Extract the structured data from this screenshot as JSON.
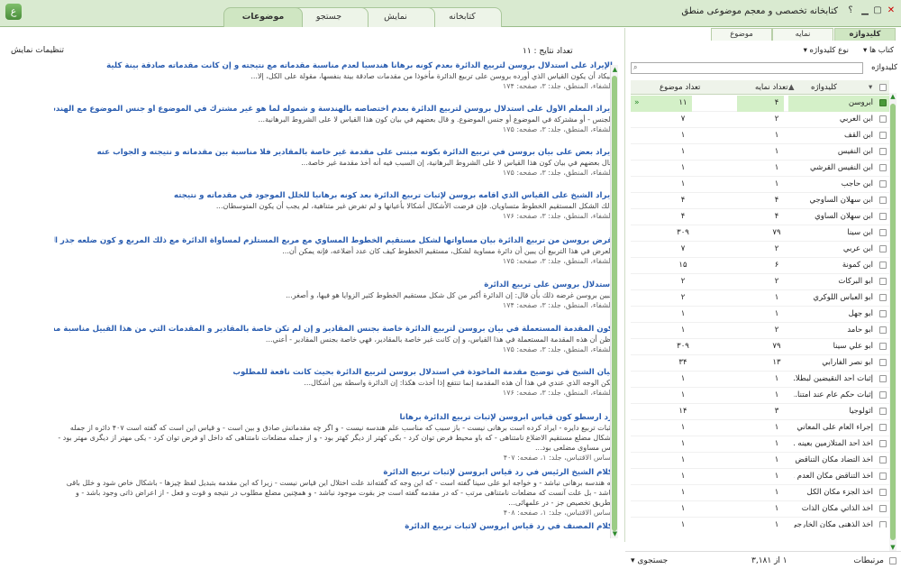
{
  "window": {
    "title": "کتابخانه تخصصی و معجم موضوعی منطق",
    "help_glyph": "؟",
    "minimize_glyph": "▁",
    "maximize_glyph": "▢",
    "close_glyph": "✕"
  },
  "main_tabs": [
    {
      "label": "کتابخانه"
    },
    {
      "label": "نمایش"
    },
    {
      "label": "جستجو"
    },
    {
      "label": "موضوعات"
    }
  ],
  "toolbar": {
    "settings_label": "تنظیمات نمایش",
    "results_count": "تعداد نتایج : ۱۱"
  },
  "results": [
    {
      "heading": "الإيراد على استدلال بروسن لتربيع الدائرة بعدم كونه برهانا هندسيا لعدم مناسبة مقدماته مع نتيجته و إن كانت مقدماته صادقة بينة كلية",
      "body": "فيكاد أن يكون القياس الذي أورده بروسن على تربيع الدائرة مأخوذا من مقدمات صادقة بينة بنفسها، مقولة على الكل، إلا...",
      "ref": "الشفاء، المنطق، جلد: ۳، صفحه: ۱۷۴"
    },
    {
      "heading": "إيراد المعلم الأول على استدلال بروسن لتربيع الدائرة بعدم اختصاصه بالهندسة و شموله لما هو غير مشترك في الموضوع أو جنس الموضوع مع الهندسة",
      "body": "الجنس - أو مشتركة في الموضوع أو جنس الموضوع. و قال بعضهم في بيان كون هذا القياس لا على الشروط البرهانية...",
      "ref": "الشفاء، المنطق، جلد: ۳، صفحه: ۱۷۵"
    },
    {
      "heading": "إيراد بعض على بيان بروسن في تربيع الدائرة بكونه مبتنى على مقدمة غير خاصة بالمقادير فلا مناسبة بين مقدماته و نتيجته و الجواب عنه",
      "body": "قال بعضهم في بيان كون هذا القياس لا على الشروط البرهانية، إن السبب فيه أنه أخذ مقدمة غير خاصة...",
      "ref": "الشفاء، المنطق، جلد: ۳، صفحه: ۱۷۵"
    },
    {
      "heading": "إيراد الشيخ على القياس الذي أقامه بروسن لإثبات تربيع الدائرة بعد كونه برهانيا للخلل الموجود في مقدماته و نتيجته",
      "body": "ذلك الشكل المستقيم الخطوط متساويان. فإن فرضت الأشكال أشكالا بأعيانها و لم تفرض غير متناهية، لم يجب أن يكون المتوسطان...",
      "ref": "الشفاء، المنطق، جلد: ۳، صفحه: ۱۷۶"
    },
    {
      "heading": "غرض بروسن من تربيع الدائرة بيان مساواتها لشكل مستقيم الخطوط المساوي مع مربع المستلزم لمساواة الدائرة مع ذلك المربع و كون ضلعه جذر الدائرة",
      "body": "العرض في هذا التربيع أن يبين أن دائرة مساوية لشكل، مستقيم الخطوط كيف كان عدد أضلاعه، فإنه يمكن أن...",
      "ref": "الشفاء، المنطق، جلد: ۳، صفحه: ۱۷۵"
    },
    {
      "heading": "استدلال بروسن على تربيع الدائرة",
      "body": "فبين بروسن غرضه ذلك بأن قال: إن الدائرة أكبر من كل شكل مستقيم الخطوط كثير الزوايا هو فيها، و أصغر...",
      "ref": "الشفاء، المنطق، جلد: ۳، صفحه: ۱۷۴"
    },
    {
      "heading": "كون المقدمة المستعملة في بيان بروسن لتربيع الدائرة خاصة بجنس المقادير و إن لم تكن خاصة بالمقادير و المقدمات التي من هذا القبيل مناسبة مستعملة في العلوم و وجهه",
      "body": "أظن أن هذه المقدمة المستعملة في هذا القياس، و إن كانت غير خاصة بالمقادير، فهي خاصة بجنس المقادير - أعني...",
      "ref": "الشفاء، المنطق، جلد: ۳، صفحه: ۱۷۵"
    },
    {
      "heading": "بيان الشيخ في توضيح مقدمة المأخوذة في استدلال بروسن لتربيع الدائرة بحيث كانت نافعة للمطلوب",
      "body": "لكن الوجه الذي عندي في هذا أن هذه المقدمة إنما تنتفع إذا أخذت هكذا: إن الدائرة واسطة بين أشكال...",
      "ref": "الشفاء، المنطق، جلد: ۳، صفحه: ۱۷۶"
    },
    {
      "heading": "رد أرسطو كون قياس ابروسن لإثبات تربيع الدائرة برهانا",
      "body": "اثبات تربیع دایره - ایراد کرده است برهانی نیست - باز سبب که مناسب علم هندسه نیست - و اگر چه مقدماتش صادق و بین است - و قیاس این است که گفته است ۴۰۷ دائره از جمله اشکال مضلع مستقیم الاضلاع نامتناهی - که باو محیط فرض توان کرد - بکی کهتر از دیگر کهتر بود - و از جمله مضلعات نامتناهی که داخل او فرض توان کرد - یکی مهتر از دیگری مهتر بود - پس مساوی مضلعی بود...",
      "ref": "اساس الاقتباس، جلد: ۱، صفحه: ۴۰۷"
    },
    {
      "heading": "كلام الشيخ الرئيس في رد قياس ابروسن لإثبات تربيع الدائرة",
      "body": "به هندسه برهانی نباشد - و خواجه ابو علی سینا گفته است - که این وجه که گفته‌اند علت اختلال این قیاس نیست - زیرا که این مقدمه بتبدیل لفظ چیزها - باشکال خاص شود و خلل باقی باشد - بل علت آنست که مضلعات نامتناهی مرتب - که در مقدمه گفته است جز بقوت موجود نباشد - و همچنین مضلع مطلوب در نتیجه و قوت و فعل - از اعراض ذاتی وجود باشد - و بطریق تخصیص جز - در علمهائی...",
      "ref": "اساس الاقتباس، جلد: ۱، صفحه: ۴۰۸"
    },
    {
      "heading": "كلام المصنف في رد قياس ابروسن لاثبات تربيع الدائرة",
      "body": "",
      "ref": ""
    }
  ],
  "panel": {
    "subtabs": [
      {
        "label": "کلیدواژه"
      },
      {
        "label": "نمایه"
      },
      {
        "label": "موضوع"
      }
    ],
    "books_filter": "کتاب ها",
    "keyword_type_filter": "نوع کلیدواژه",
    "keyword_label": "کلیدواژه",
    "search_placeholder": "",
    "columns": {
      "keyword": "کلیدواژه",
      "index_count": "تعداد نمایه",
      "topic_count": "تعداد موضوع"
    },
    "rows": [
      {
        "name": "أبروسن",
        "index": "۴",
        "topic": "۱۱",
        "selected": true,
        "checked": true
      },
      {
        "name": "ابن العربي",
        "index": "۲",
        "topic": "۷"
      },
      {
        "name": "ابن ألقف",
        "index": "۱",
        "topic": "۱"
      },
      {
        "name": "ابن النفيس",
        "index": "۱",
        "topic": "۱"
      },
      {
        "name": "ابن النفيس القرشي",
        "index": "۱",
        "topic": "۱"
      },
      {
        "name": "ابن حاجب",
        "index": "۱",
        "topic": "۱"
      },
      {
        "name": "ابن سهلان الساوجي",
        "index": "۴",
        "topic": "۴"
      },
      {
        "name": "ابن سهلان الساوي",
        "index": "۴",
        "topic": "۴"
      },
      {
        "name": "ابن سينا",
        "index": "۷۹",
        "topic": "۳۰۹"
      },
      {
        "name": "ابن عربي",
        "index": "۲",
        "topic": "۷"
      },
      {
        "name": "ابن كمونة",
        "index": "۶",
        "topic": "۱۵"
      },
      {
        "name": "أبو البركات",
        "index": "۲",
        "topic": "۲"
      },
      {
        "name": "أبو العباس اللوكري",
        "index": "۱",
        "topic": "۲"
      },
      {
        "name": "أبو جهل",
        "index": "۱",
        "topic": "۱"
      },
      {
        "name": "أبو حامد",
        "index": "۲",
        "topic": "۱"
      },
      {
        "name": "أبو علي سينا",
        "index": "۷۹",
        "topic": "۳۰۹"
      },
      {
        "name": "أبو نصر الفارابي",
        "index": "۱۳",
        "topic": "۳۴"
      },
      {
        "name": "إثبات أحد النقيضين لبطلا...",
        "index": "۱",
        "topic": "۱"
      },
      {
        "name": "إثبات حكم عام عند امتنا...",
        "index": "۱",
        "topic": "۱"
      },
      {
        "name": "أثولوجيا",
        "index": "۳",
        "topic": "۱۴"
      },
      {
        "name": "إجراء العام على المعاني ال...",
        "index": "۱",
        "topic": "۱"
      },
      {
        "name": "أخذ أحد المتلازمين بعينه ...",
        "index": "۱",
        "topic": "۱"
      },
      {
        "name": "أخذ التضاد مكان التناقض",
        "index": "۱",
        "topic": "۱"
      },
      {
        "name": "أخذ التناقض مكان العدم ...",
        "index": "۱",
        "topic": "۱"
      },
      {
        "name": "أخذ الجزء مكان الكل",
        "index": "۱",
        "topic": "۱"
      },
      {
        "name": "أخذ الذاتي مكان الذات",
        "index": "۱",
        "topic": "۱"
      },
      {
        "name": "أخذ الذهني مكان الخارجي",
        "index": "۱",
        "topic": "۱"
      }
    ],
    "footer": {
      "sorted_label": "مرتبطات",
      "page_info": "۱ از ۳,۱۸۱",
      "search_button": "جستجوی"
    }
  },
  "colors": {
    "accent": "#9ccc86",
    "titlebar": "#d9ead0",
    "link": "#2a5db0",
    "selected_row": "#d4f0c8"
  }
}
